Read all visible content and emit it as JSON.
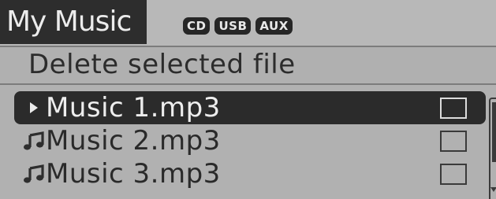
{
  "header": {
    "title": "My Music",
    "sources": [
      {
        "label": "CD"
      },
      {
        "label": "USB"
      },
      {
        "label": "AUX"
      }
    ]
  },
  "subtitle": "Delete selected file",
  "files": [
    {
      "name": "Music 1.mp3",
      "selected": true,
      "icon": "play-arrow-icon",
      "checked": false
    },
    {
      "name": "Music 2.mp3",
      "selected": false,
      "icon": "music-note-icon",
      "checked": false
    },
    {
      "name": "Music 3.mp3",
      "selected": false,
      "icon": "music-note-icon",
      "checked": false
    }
  ],
  "colors": {
    "background": "#b1b1b1",
    "highlight": "#2b2b2b",
    "text": "#2a2a2a",
    "highlight_text": "#ececec"
  }
}
